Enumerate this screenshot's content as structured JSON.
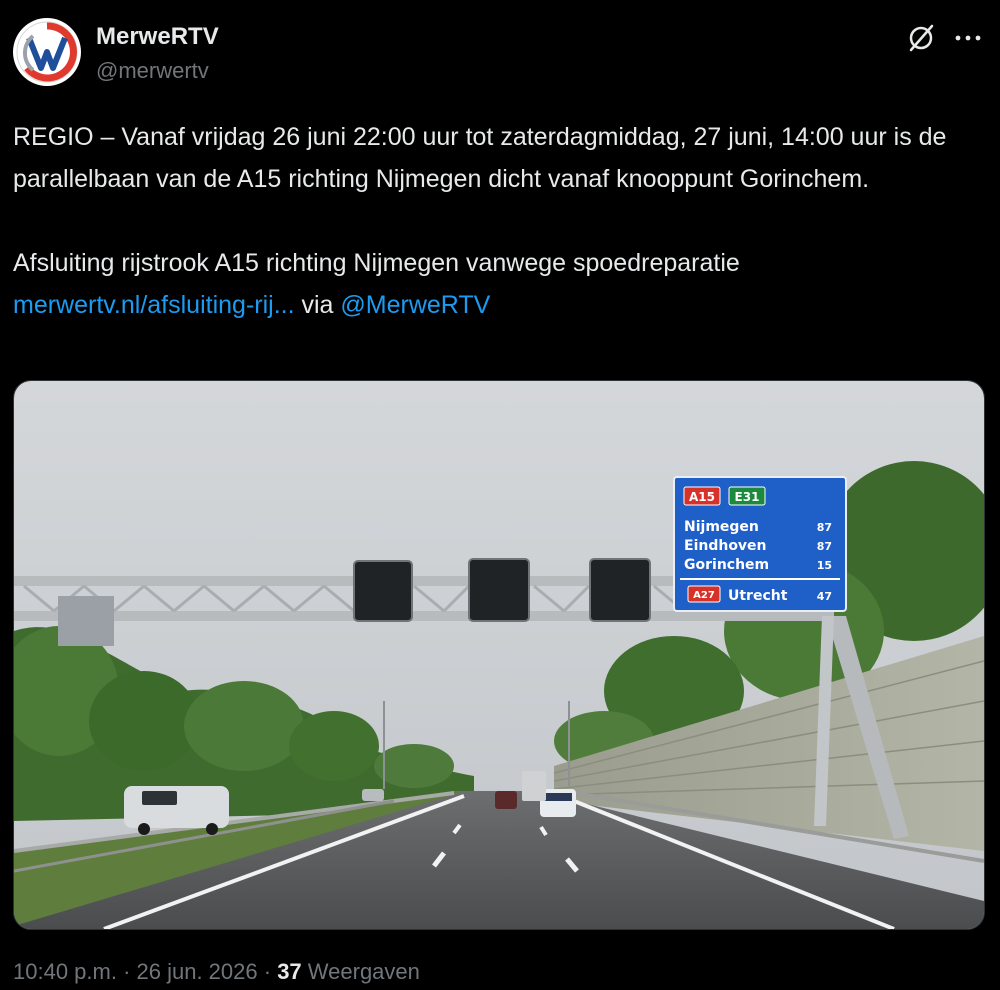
{
  "author": {
    "display_name": "MerweRTV",
    "handle": "@merwertv"
  },
  "tweet": {
    "paragraph_1": "REGIO – Vanaf vrijdag 26 juni 22:00 uur tot zaterdagmiddag, 27 juni, 14:00 uur is de parallelbaan van de A15 richting Nijmegen dicht vanaf knooppunt Gorinchem.",
    "paragraph_2_text": "Afsluiting rijstrook A15 richting Nijmegen vanwege spoedreparatie",
    "link_text": "merwertv.nl/afsluiting-rij...",
    "via_text": " via ",
    "mention": "@MerweRTV"
  },
  "media": {
    "sign": {
      "route_1": "A15",
      "route_2": "E31",
      "destinations": [
        {
          "name": "Nijmegen",
          "km": "87"
        },
        {
          "name": "Eindhoven",
          "km": "87"
        },
        {
          "name": "Gorinchem",
          "km": "15"
        }
      ],
      "exit_route": "A27",
      "exit_name": "Utrecht",
      "exit_km": "47"
    }
  },
  "meta": {
    "time": "10:40 p.m.",
    "separator": " · ",
    "date": "26 jun. 2026",
    "views_count": "37",
    "views_label": " Weergaven"
  },
  "icons": {
    "grok": "grok-icon",
    "more": "more-icon"
  },
  "colors": {
    "background": "#000000",
    "text": "#e7e9ea",
    "secondary_text": "#71767b",
    "link": "#1d9bf0",
    "sign_blue": "#1f5fc8",
    "route_red": "#d7322a",
    "route_green": "#1c8a3c"
  }
}
